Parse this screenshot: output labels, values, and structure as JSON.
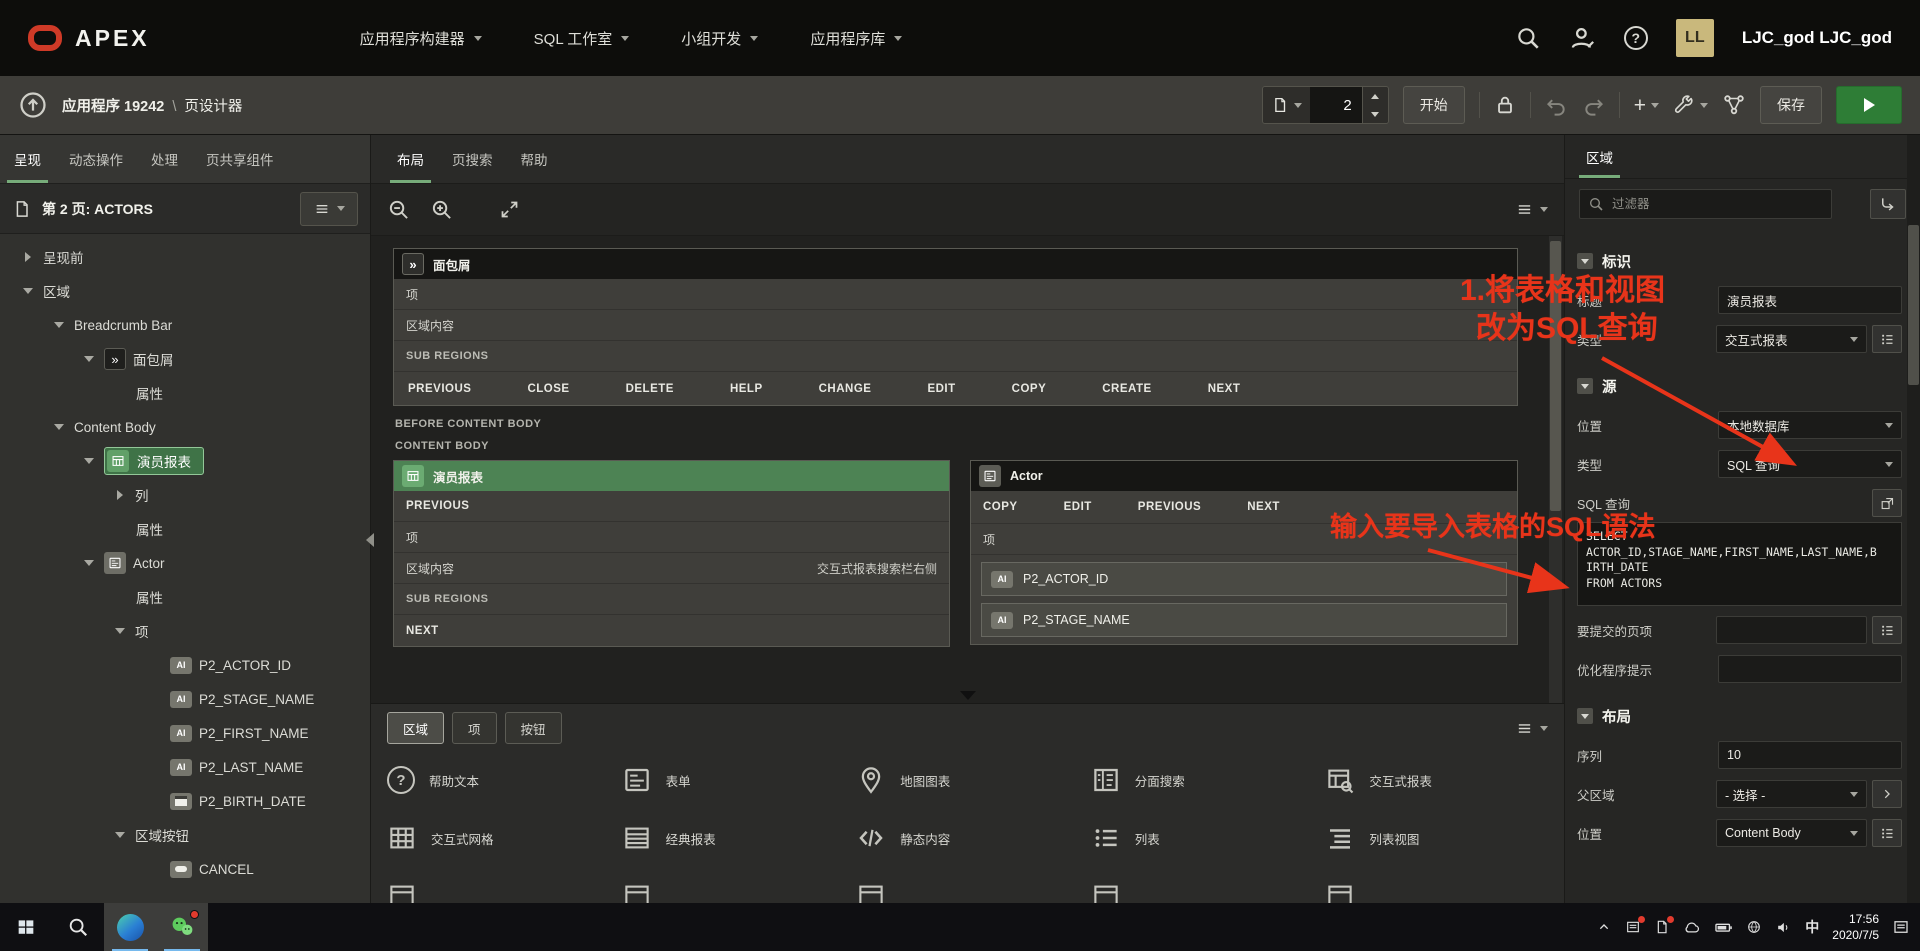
{
  "header": {
    "brand": "APEX",
    "menus": [
      "应用程序构建器",
      "SQL 工作室",
      "小组开发",
      "应用程序库"
    ],
    "user_initials": "LL",
    "user_name": "LJC_god LJC_god"
  },
  "toolbar": {
    "app_crumb": "应用程序 19242",
    "separator": "\\",
    "page_crumb": "页设计器",
    "page_number": "2",
    "go_button": "开始",
    "save_button": "保存"
  },
  "icons": {
    "breadcrumb_chip": "»",
    "item_badge": "AI",
    "help_glyph": "?"
  },
  "left_panel": {
    "tabs": [
      "呈现",
      "动态操作",
      "处理",
      "页共享组件"
    ],
    "page_title": "第 2 页: ACTORS",
    "tree": [
      "呈现前",
      "区域",
      "Breadcrumb Bar",
      "面包屑",
      "属性",
      "Content Body",
      "演员报表",
      "列",
      "属性",
      "Actor",
      "属性",
      "项",
      "P2_ACTOR_ID",
      "P2_STAGE_NAME",
      "P2_FIRST_NAME",
      "P2_LAST_NAME",
      "P2_BIRTH_DATE",
      "区域按钮",
      "CANCEL"
    ]
  },
  "canvas": {
    "tabs": [
      "布局",
      "页搜索",
      "帮助"
    ],
    "breadcrumb_region": {
      "title": "面包屑",
      "row_items": "项",
      "row_content": "区域内容",
      "row_subregions": "SUB REGIONS",
      "buttons": [
        "PREVIOUS",
        "CLOSE",
        "DELETE",
        "HELP",
        "CHANGE",
        "EDIT",
        "COPY",
        "CREATE",
        "NEXT"
      ]
    },
    "before_content_label": "BEFORE CONTENT BODY",
    "content_body_label": "CONTENT BODY",
    "report_region": {
      "title": "演员报表",
      "row_previous": "PREVIOUS",
      "row_items": "项",
      "row_content": "区域内容",
      "content_hint": "交互式报表搜索栏右侧",
      "row_subregions": "SUB REGIONS",
      "row_next": "NEXT"
    },
    "actor_region": {
      "title": "Actor",
      "buttons": [
        "COPY",
        "EDIT",
        "PREVIOUS",
        "NEXT"
      ],
      "row_items": "项",
      "items": [
        "P2_ACTOR_ID",
        "P2_STAGE_NAME"
      ]
    },
    "gallery": {
      "tabs": [
        "区域",
        "项",
        "按钮"
      ],
      "items": [
        "帮助文本",
        "表单",
        "地图图表",
        "分面搜索",
        "交互式报表",
        "交互式网格",
        "经典报表",
        "静态内容",
        "列表",
        "列表视图"
      ]
    }
  },
  "right_panel": {
    "tab": "区域",
    "filter_placeholder": "过滤器",
    "identification": {
      "title": "标识",
      "title_label": "标题",
      "title_value": "演员报表",
      "type_label": "类型",
      "type_value": "交互式报表"
    },
    "source": {
      "title": "源",
      "location_label": "位置",
      "location_value": "本地数据库",
      "type_label": "类型",
      "type_value": "SQL 查询",
      "sql_label": "SQL 查询",
      "sql_text": "SELECT\nACTOR_ID,STAGE_NAME,FIRST_NAME,LAST_NAME,B\nIRTH_DATE\nFROM ACTORS",
      "page_items_label": "要提交的页项",
      "optimizer_label": "优化程序提示"
    },
    "layout": {
      "title": "布局",
      "sequence_label": "序列",
      "sequence_value": "10",
      "parent_label": "父区域",
      "parent_value": "- 选择 -",
      "position_label": "位置",
      "position_value": "Content Body"
    }
  },
  "annotations": {
    "color": "#e8341a",
    "note1_line1": "1.将表格和视图",
    "note1_line2": "改为SQL查询",
    "note2": "输入要导入表格的SQL语法"
  },
  "taskbar": {
    "input_method": "中",
    "time": "17:56",
    "date": "2020/7/5"
  }
}
